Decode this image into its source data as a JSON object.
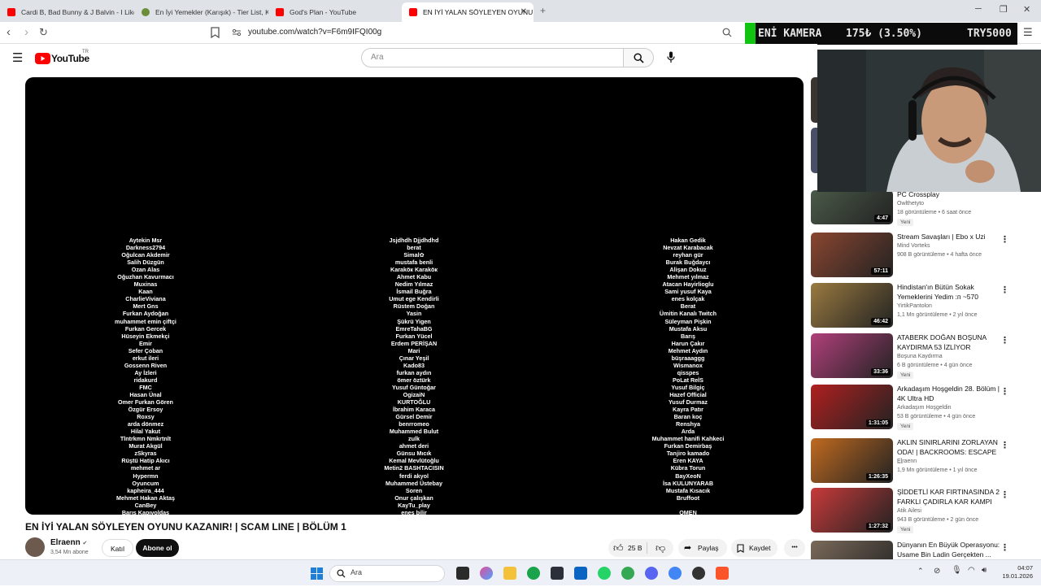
{
  "browser": {
    "tabs": [
      {
        "title": "Cardi B, Bad Bunny & J Balvin - I Like..."
      },
      {
        "title": "En İyi Yemekler (Karışık) - Tier List, Ko..."
      },
      {
        "title": "God's Plan - YouTube"
      },
      {
        "title": "EN İYİ YALAN SÖYLEYEN OYUNU..."
      }
    ],
    "new_tab": "+",
    "url": "youtube.com/watch?v=F6m9IFQI00g"
  },
  "overlay": {
    "label": "ENİ KAMERA",
    "amount": "175₺ (3.50%)",
    "target": "TRY5000"
  },
  "youtube": {
    "logo_text": "YouTube",
    "country": "TR",
    "search_placeholder": "Ara"
  },
  "video": {
    "credits_col1": [
      "Aytekin Msr",
      "Darkness2794",
      "Oğulcan Akdemir",
      "Salih Düzgün",
      "Ozan Alas",
      "Oğuzhan Kavurmacı",
      "Muxinas",
      "Kaan",
      "CharlieViviana",
      "Mert Gns",
      "Furkan Aydoğan",
      "muhammet emin çiftçi",
      "Furkan Gercek",
      "Hüseyin Ekmekçi",
      "Emir",
      "Sefer Çoban",
      "erkut ileri",
      "Gossenn Riven",
      "Ay İzleri",
      "ridakurd",
      "FMC",
      "Hasan Ünal",
      "Omer Furkan Gören",
      "Özgür Ersoy",
      "Roxsy",
      "arda dönmez",
      "Hilal Yakut",
      "Tlntrkmn Nmkrtnlt",
      "Murat Akgül",
      "zSkyras",
      "Rüştü Hatip Akıcı",
      "mehmet ar",
      "Hypermn",
      "Oyuncum",
      "kapheira_444",
      "Mehmet Hakan Aktaş",
      "CanBey",
      "Barış Kapıvoldaş"
    ],
    "credits_col2": [
      "Jsjdhdh Djjdhdhd",
      "berat",
      "Simal✿",
      "mustafa benli",
      "Karaköк Karaköк",
      "Ahmet Kabu",
      "Nedim Yılmaz",
      "İsmail Buğra",
      "Umut ege Kendirli",
      "Rüstem Doğan",
      "Yasin",
      "Şükrü Yigen",
      "EmreTahaBG",
      "Furkan Yücel",
      "Erdem PERİŞAN",
      "Mari",
      "Çınar Yeşil",
      "Kado83",
      "furkan aydın",
      "ömer öztürk",
      "Yusuf Güntoğar",
      "OgizaiN",
      "KURTOĞLU",
      "İbrahim Karaca",
      "Gürsel Demir",
      "benrromeo",
      "Muhammed Bulut",
      "zulk",
      "ahmet deri",
      "Günsu Mıcık",
      "Kemal Mevlütoğlu",
      "Metin2 BASHTACISIN",
      "ferdi akyol",
      "Muhammed Üstebay",
      "Soren",
      "Onur çalışkan",
      "KayTu_play",
      "enes bilir"
    ],
    "credits_col3": [
      "Hakan Gedik",
      "Nevzat Karabacak",
      "reyhan gür",
      "Burak Buğdaycı",
      "Alişan Dokuz",
      "Mehmet yılmaz",
      "Atacan Hayirlioglu",
      "Sami yusuf Kaya",
      "enes kolçak",
      "Berat",
      "Ümitin Kanalı Twitch",
      "Süleyman Pişkin",
      "Mustafa Aksu",
      "Barış",
      "Harun Çakır",
      "Mehmet Aydın",
      "büşraaaggg",
      "Wismanox",
      "qisspes",
      "PoLat ReİS",
      "Yusuf Bilgiç",
      "Hazef Official",
      "Yusuf Durmaz",
      "Kayra Patır",
      "Baran koç",
      "Renshya",
      "Arda",
      "Muhammet hanifi Kahkeci",
      "Furkan Demirbaş",
      "Tanjiro kamado",
      "Eren KAYA",
      "Kübra Torun",
      "BayXeoN",
      "İsa KULUNYARAB",
      "Mustafa Kısacık",
      "Bruffoot",
      "",
      "OMEN"
    ],
    "title": "EN İYİ YALAN SÖYLEYEN OYUNU KAZANIR! | SCAM LINE | BÖLÜM 1",
    "channel": "Elraenn",
    "subscribers": "3,54 Mn abone",
    "join_label": "Katıl",
    "subscribe_label": "Abone ol",
    "likes": "25 B",
    "share_label": "Paylaş",
    "save_label": "Kaydet",
    "more_label": "•••"
  },
  "recommendations": [
    {
      "title": "PC Crossplay",
      "channel": "Owlthetyto",
      "meta": "18 görüntüleme • 6 saat önce",
      "badge": "Yeni",
      "duration": "4:47",
      "color": "#4a5a48"
    },
    {
      "title": "Stream Savaşları | Ebo x Uzi",
      "channel": "Mind Vorteks",
      "meta": "908 B görüntüleme • 4 hafta önce",
      "badge": "",
      "duration": "57:11",
      "color": "#8a4630"
    },
    {
      "title": "Hindistan'ın Bütün Sokak Yemeklerini Yedim :ᴨ ~570",
      "channel": "YirtikPantolon",
      "meta": "1,1 Mn görüntüleme • 2 yıl önce",
      "badge": "",
      "duration": "46:42",
      "color": "#9a7a40"
    },
    {
      "title": "ATABERK DOĞAN BOŞUNA KAYDIRMA 53 İZLİYOR",
      "channel": "Boşuna Kaydırma",
      "meta": "6 B görüntüleme • 4 gün önce",
      "badge": "Yeni",
      "duration": "33:36",
      "color": "#b0407a"
    },
    {
      "title": "Arkadaşım Hoşgeldin 28. Bölüm | 4K Ultra HD",
      "channel": "Arkadaşım Hoşgeldin",
      "meta": "53 B görüntüleme • 4 gün önce",
      "badge": "Yeni",
      "duration": "1:31:05",
      "color": "#b02020"
    },
    {
      "title": "AKLIN SINIRLARINI ZORLAYAN ODA! | BACKROOMS: ESCAPE ...",
      "channel": "Elraenn",
      "meta": "1,9 Mn görüntüleme • 1 yıl önce",
      "badge": "",
      "duration": "1:26:35",
      "color": "#c06a20"
    },
    {
      "title": "ŞİDDETLİ KAR FIRTINASINDA 2 FARKLI ÇADIRLA KAR KAMPI",
      "channel": "Atik Ailesi",
      "meta": "943 B görüntüleme • 2 gün önce",
      "badge": "Yeni",
      "duration": "1:27:32",
      "color": "#c83a3a"
    },
    {
      "title": "Dünyanın En Büyük Operasyonu: Usame Bin Ladin Gerçekten ...",
      "channel": "",
      "meta": "",
      "badge": "",
      "duration": "",
      "color": "#7a6a5a"
    }
  ],
  "taskbar": {
    "search_placeholder": "Ara",
    "time": "04:07",
    "date": "19.01.2026"
  }
}
